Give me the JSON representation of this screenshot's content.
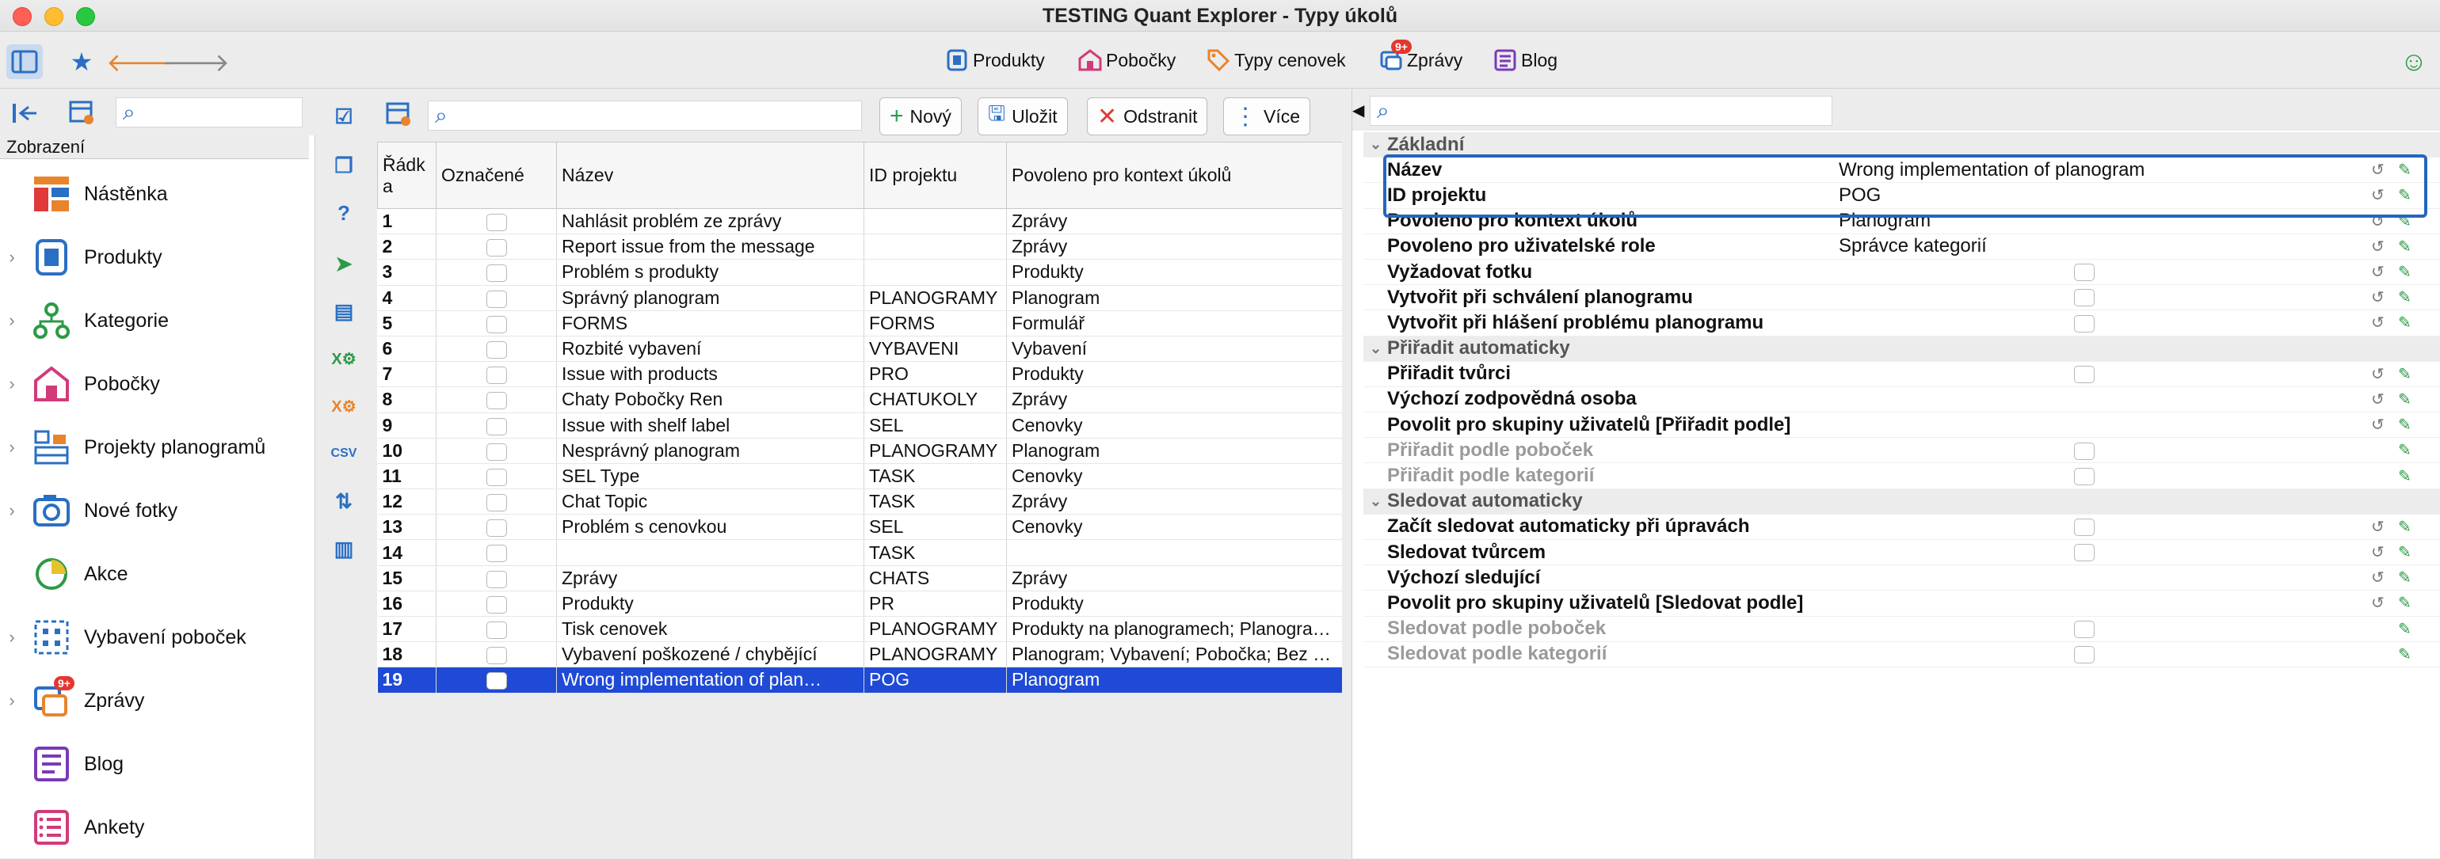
{
  "window": {
    "title": "TESTING Quant Explorer - Typy úkolů"
  },
  "toolbar": {
    "items": [
      {
        "label": "Produkty",
        "icon": "product-icon"
      },
      {
        "label": "Pobočky",
        "icon": "store-icon"
      },
      {
        "label": "Typy cenovek",
        "icon": "price-tag-icon"
      },
      {
        "label": "Zprávy",
        "icon": "messages-icon",
        "badge": "9+"
      },
      {
        "label": "Blog",
        "icon": "blog-icon"
      }
    ]
  },
  "sidebar": {
    "section": "Zobrazení",
    "items": [
      {
        "label": "Nástěnka",
        "icon": "dashboard-icon",
        "expandable": false
      },
      {
        "label": "Produkty",
        "icon": "product-icon",
        "expandable": true
      },
      {
        "label": "Kategorie",
        "icon": "category-icon",
        "expandable": true
      },
      {
        "label": "Pobočky",
        "icon": "store-icon",
        "expandable": true
      },
      {
        "label": "Projekty planogramů",
        "icon": "planogram-icon",
        "expandable": true
      },
      {
        "label": "Nové fotky",
        "icon": "camera-icon",
        "expandable": true
      },
      {
        "label": "Akce",
        "icon": "promotion-icon",
        "expandable": false
      },
      {
        "label": "Vybavení poboček",
        "icon": "equipment-icon",
        "expandable": true
      },
      {
        "label": "Zprávy",
        "icon": "messages-icon",
        "expandable": true,
        "badge": "9+"
      },
      {
        "label": "Blog",
        "icon": "blog-icon",
        "expandable": false
      },
      {
        "label": "Ankety",
        "icon": "survey-icon",
        "expandable": false
      }
    ]
  },
  "table_toolbar": {
    "new_label": "Nový",
    "save_label": "Uložit",
    "delete_label": "Odstranit",
    "more_label": "Více"
  },
  "table": {
    "columns": [
      "Řádka",
      "Označené",
      "Název",
      "ID projektu",
      "Povoleno pro kontext úkolů"
    ],
    "rows": [
      {
        "n": "1",
        "name": "Nahlásit problém ze zprávy",
        "pid": "",
        "ctx": "Zprávy"
      },
      {
        "n": "2",
        "name": "Report issue from the message",
        "pid": "",
        "ctx": "Zprávy"
      },
      {
        "n": "3",
        "name": "Problém s produkty",
        "pid": "",
        "ctx": "Produkty"
      },
      {
        "n": "4",
        "name": "Správný planogram",
        "pid": "PLANOGRAMY",
        "ctx": "Planogram"
      },
      {
        "n": "5",
        "name": "FORMS",
        "pid": "FORMS",
        "ctx": "Formulář"
      },
      {
        "n": "6",
        "name": "Rozbité vybavení",
        "pid": "VYBAVENI",
        "ctx": "Vybavení"
      },
      {
        "n": "7",
        "name": "Issue with products",
        "pid": "PRO",
        "ctx": "Produkty"
      },
      {
        "n": "8",
        "name": "Chaty Pobočky Ren",
        "pid": "CHATUKOLY",
        "ctx": "Zprávy"
      },
      {
        "n": "9",
        "name": "Issue with shelf label",
        "pid": "SEL",
        "ctx": "Cenovky"
      },
      {
        "n": "10",
        "name": "Nesprávný planogram",
        "pid": "PLANOGRAMY",
        "ctx": "Planogram"
      },
      {
        "n": "11",
        "name": "SEL Type",
        "pid": "TASK",
        "ctx": "Cenovky"
      },
      {
        "n": "12",
        "name": "Chat Topic",
        "pid": "TASK",
        "ctx": "Zprávy"
      },
      {
        "n": "13",
        "name": "Problém s cenovkou",
        "pid": "SEL",
        "ctx": "Cenovky"
      },
      {
        "n": "14",
        "name": "",
        "pid": "TASK",
        "ctx": ""
      },
      {
        "n": "15",
        "name": "Zprávy",
        "pid": "CHATS",
        "ctx": "Zprávy"
      },
      {
        "n": "16",
        "name": "Produkty",
        "pid": "PR",
        "ctx": "Produkty"
      },
      {
        "n": "17",
        "name": "Tisk cenovek",
        "pid": "PLANOGRAMY",
        "ctx": "Produkty na planogramech; Planogra…"
      },
      {
        "n": "18",
        "name": "Vybavení poškozené / chybějící",
        "pid": "PLANOGRAMY",
        "ctx": "Planogram; Vybavení; Pobočka; Bez …"
      },
      {
        "n": "19",
        "name": "Wrong implementation of plan…",
        "pid": "POG",
        "ctx": "Planogram",
        "selected": true
      }
    ]
  },
  "properties": {
    "rows": [
      {
        "type": "group",
        "label": "Základní"
      },
      {
        "type": "text",
        "label": "Název",
        "value": "Wrong implementation of planogram"
      },
      {
        "type": "text",
        "label": "ID projektu",
        "value": "POG"
      },
      {
        "type": "text",
        "label": "Povoleno pro kontext úkolů",
        "value": "Planogram"
      },
      {
        "type": "text",
        "label": "Povoleno pro uživatelské role",
        "value": "Správce kategorií"
      },
      {
        "type": "check",
        "label": "Vyžadovat fotku"
      },
      {
        "type": "check",
        "label": "Vytvořit při schválení planogramu"
      },
      {
        "type": "check",
        "label": "Vytvořit při hlášení problému planogramu"
      },
      {
        "type": "group",
        "label": "Přiřadit automaticky"
      },
      {
        "type": "check",
        "label": "Přiřadit tvůrci"
      },
      {
        "type": "text",
        "label": "Výchozí zodpovědná osoba",
        "value": ""
      },
      {
        "type": "text",
        "label": "Povolit pro skupiny uživatelů [Přiřadit podle]",
        "value": ""
      },
      {
        "type": "check",
        "label": "Přiřadit podle poboček",
        "dim": true
      },
      {
        "type": "check",
        "label": "Přiřadit podle kategorií",
        "dim": true
      },
      {
        "type": "group",
        "label": "Sledovat automaticky"
      },
      {
        "type": "check",
        "label": "Začít sledovat automaticky při úpravách"
      },
      {
        "type": "check",
        "label": "Sledovat tvůrcem"
      },
      {
        "type": "text",
        "label": "Výchozí sledující",
        "value": ""
      },
      {
        "type": "text",
        "label": "Povolit pro skupiny uživatelů [Sledovat podle]",
        "value": ""
      },
      {
        "type": "check",
        "label": "Sledovat podle poboček",
        "dim": true
      },
      {
        "type": "check",
        "label": "Sledovat podle kategorií",
        "dim": true
      }
    ]
  }
}
